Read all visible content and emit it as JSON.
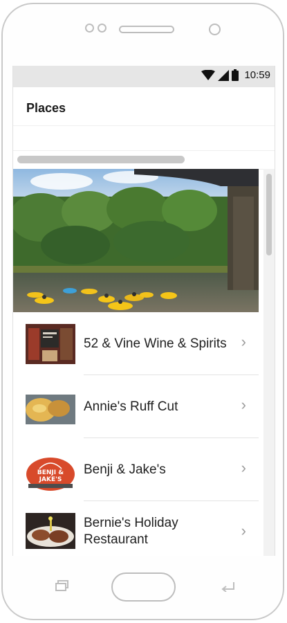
{
  "status_bar": {
    "time": "10:59",
    "icons": [
      "wifi-icon",
      "cell-signal-icon",
      "battery-icon"
    ]
  },
  "header": {
    "title": "Places"
  },
  "places": [
    {
      "name": "52 & Vine Wine & Spirits",
      "thumb": "wine-shop-photo"
    },
    {
      "name": "Annie's Ruff Cut",
      "thumb": "food-plate-photo"
    },
    {
      "name": "Benji & Jake's",
      "thumb": "benji-jakes-logo"
    },
    {
      "name": "Bernie's Holiday Restaurant",
      "thumb": "steak-dish-photo"
    }
  ],
  "logo_text": "BENJI & JAKE'S",
  "colors": {
    "status_bar": "#e6e6e6",
    "chevron": "#9a9a9a",
    "logo_red": "#d84a2b"
  }
}
